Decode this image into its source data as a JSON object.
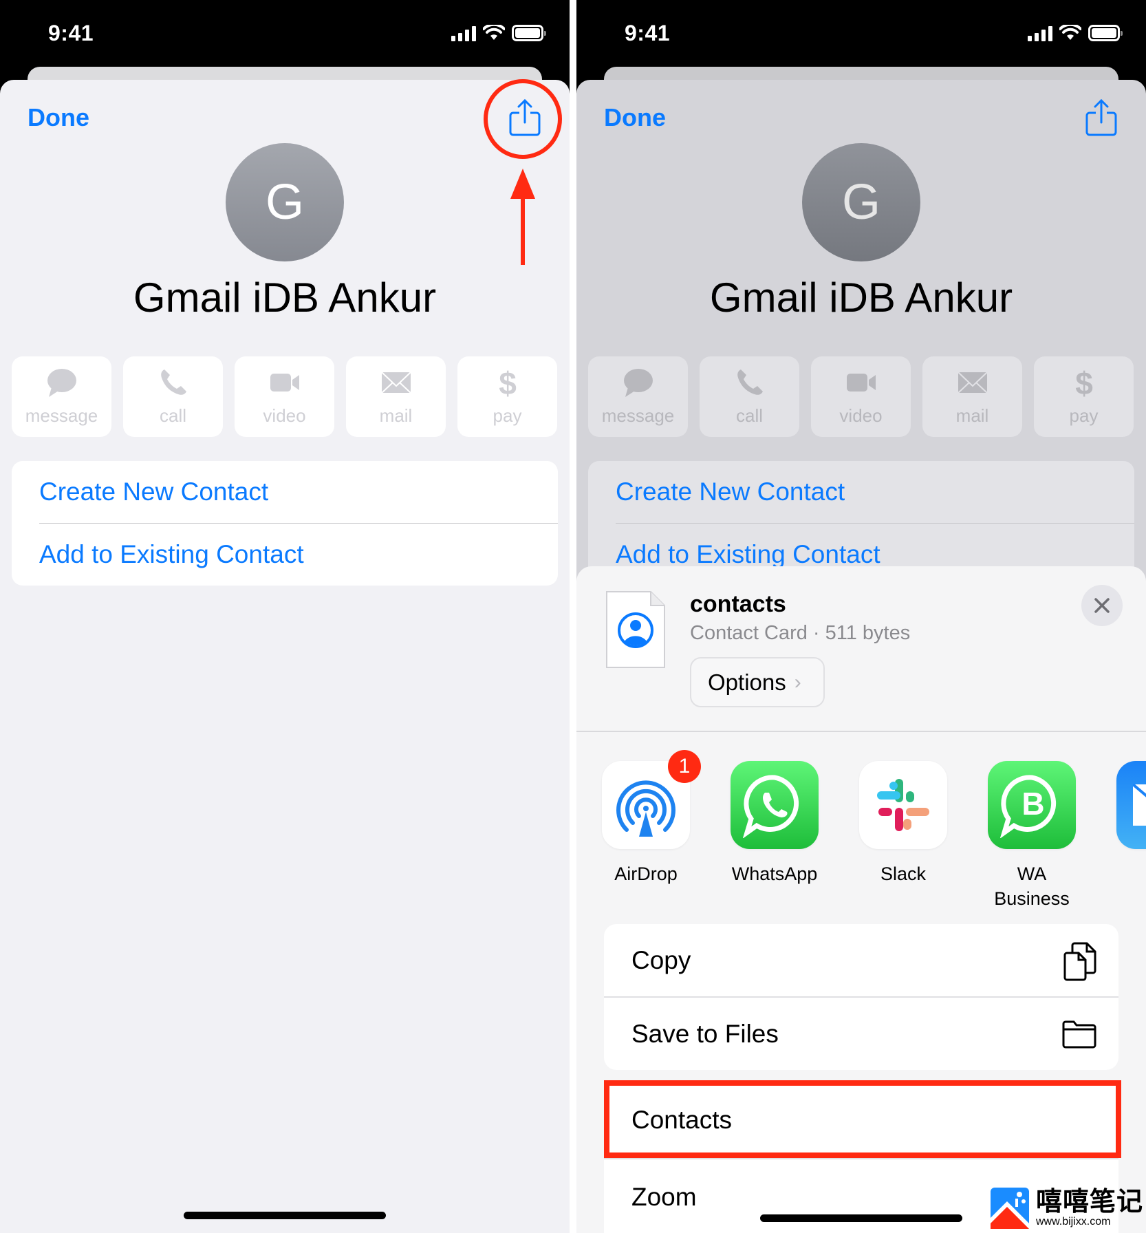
{
  "status_bar": {
    "time": "9:41"
  },
  "contact": {
    "done_label": "Done",
    "avatar_initial": "G",
    "name": "Gmail iDB Ankur",
    "actions": [
      {
        "label": "message",
        "icon": "message-bubble-icon"
      },
      {
        "label": "call",
        "icon": "phone-icon"
      },
      {
        "label": "video",
        "icon": "video-camera-icon"
      },
      {
        "label": "mail",
        "icon": "envelope-icon"
      },
      {
        "label": "pay",
        "icon": "dollar-icon"
      }
    ],
    "options": [
      {
        "label": "Create New Contact"
      },
      {
        "label": "Add to Existing Contact"
      }
    ]
  },
  "share_sheet": {
    "file_name": "contacts",
    "file_meta": "Contact Card · 511 bytes",
    "options_label": "Options",
    "apps": [
      {
        "label": "AirDrop",
        "badge": "1"
      },
      {
        "label": "WhatsApp"
      },
      {
        "label": "Slack"
      },
      {
        "label": "WA\nBusiness",
        "line1": "WA",
        "line2": "Business"
      },
      {
        "label": ""
      }
    ],
    "actions_group": [
      {
        "label": "Copy",
        "icon": "copy-icon"
      },
      {
        "label": "Save to Files",
        "icon": "folder-icon"
      }
    ],
    "apps_actions": [
      {
        "label": "Contacts",
        "highlighted": true
      },
      {
        "label": "Zoom"
      }
    ]
  },
  "watermark": {
    "name": "嘻嘻笔记",
    "url": "www.bijixx.com"
  },
  "colors": {
    "accent": "#0a7aff",
    "annotation": "#ff2a12"
  }
}
